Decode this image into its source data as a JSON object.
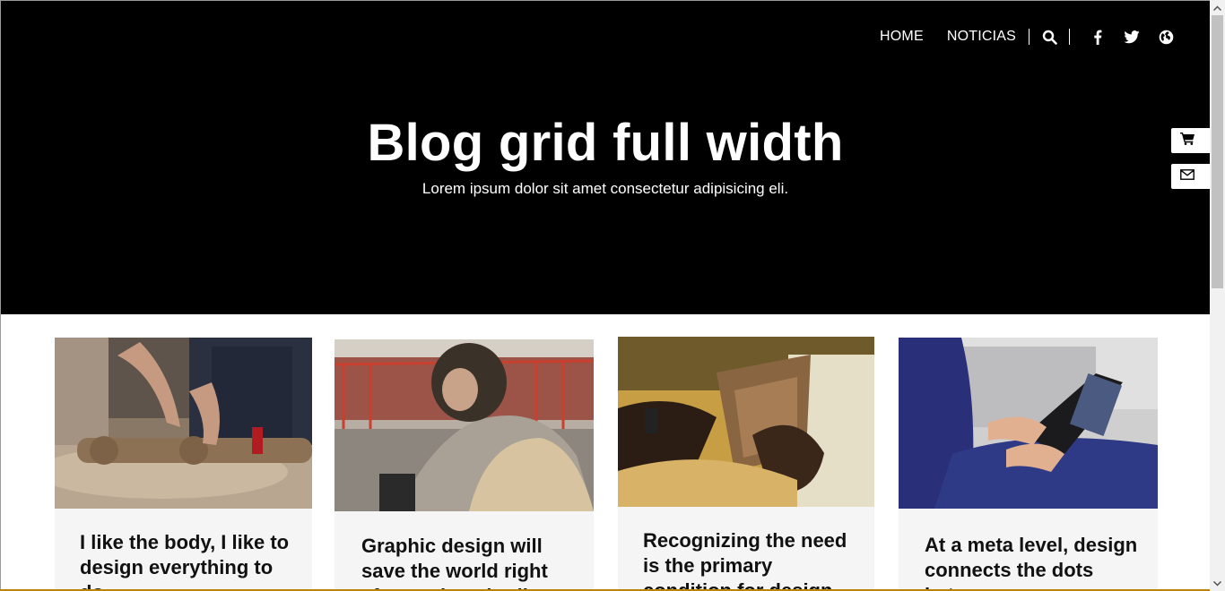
{
  "nav": {
    "links": [
      "HOME",
      "NOTICIAS"
    ],
    "icons": [
      "search-icon",
      "facebook-icon",
      "twitter-icon",
      "globe-icon"
    ]
  },
  "hero": {
    "title": "Blog grid full width",
    "subtitle": "Lorem ipsum dolor sit amet consectetur adipisicing eli."
  },
  "side_buttons": [
    "cart-icon",
    "mail-icon"
  ],
  "posts": [
    {
      "title": "I like the body, I like to design everything to do",
      "image": "woodcarver-hands-photo"
    },
    {
      "title": "Graphic design will save the world right after rock and roll",
      "image": "helmet-rider-photo"
    },
    {
      "title": "Recognizing the need is the primary condition for design",
      "image": "leather-hands-photo"
    },
    {
      "title": "At a meta level, design connects the dots between",
      "image": "laptop-person-photo"
    }
  ],
  "colors": {
    "hero_bg": "#000000",
    "card_bg": "#f5f5f5",
    "text": "#111111",
    "accent_line": "#b8860b"
  }
}
